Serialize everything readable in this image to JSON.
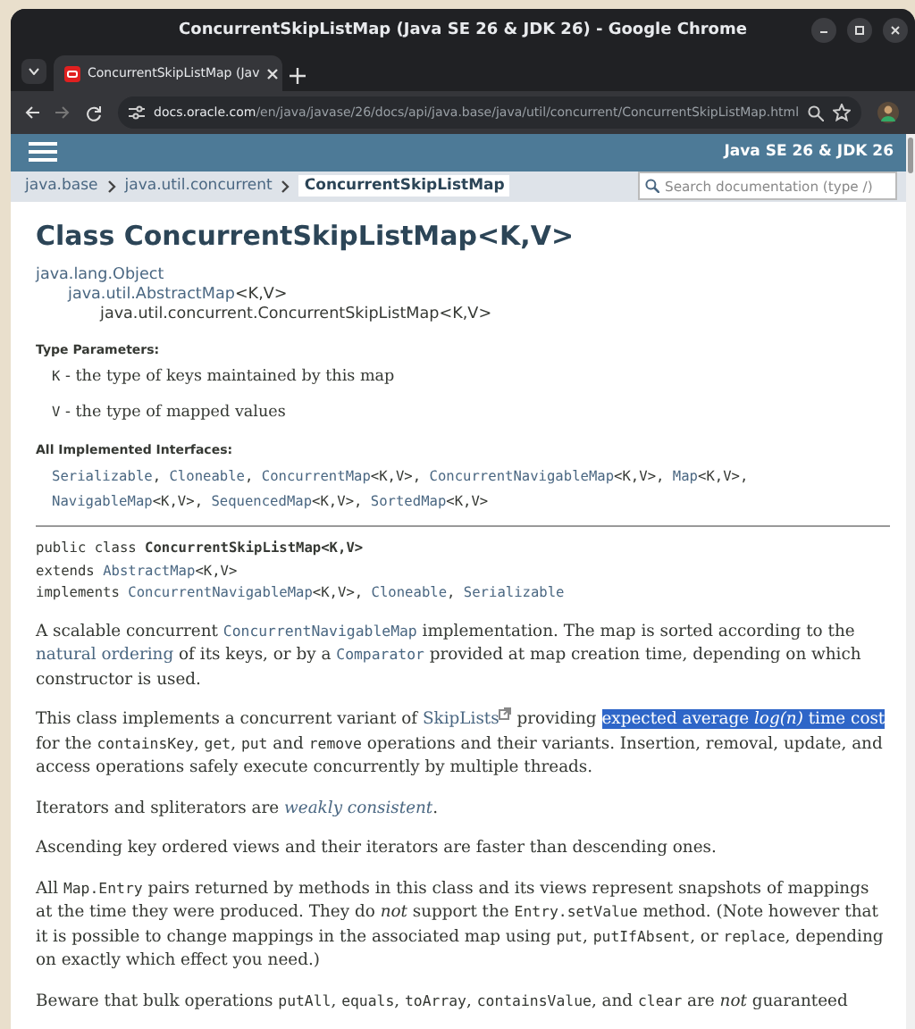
{
  "window": {
    "title": "ConcurrentSkipListMap (Java SE 26 & JDK 26) - Google Chrome"
  },
  "browser": {
    "tab_title": "ConcurrentSkipListMap (Jav",
    "url_host": "docs.oracle.com",
    "url_path": "/en/java/javase/26/docs/api/java.base/java/util/concurrent/ConcurrentSkipListMap.html"
  },
  "header": {
    "version": "Java SE 26 & JDK 26"
  },
  "breadcrumbs": [
    {
      "label": "java.base",
      "selected": false
    },
    {
      "label": "java.util.concurrent",
      "selected": false
    },
    {
      "label": "ConcurrentSkipListMap",
      "selected": true
    }
  ],
  "search": {
    "placeholder": "Search documentation (type /)"
  },
  "title": "Class ConcurrentSkipListMap<K,V>",
  "inheritance": [
    {
      "parts": [
        {
          "kind": "link",
          "text": "java.lang.Object"
        }
      ],
      "children": [
        {
          "parts": [
            {
              "kind": "link",
              "text": "java.util.AbstractMap"
            },
            {
              "kind": "text",
              "text": "<K,V>"
            }
          ],
          "children": [
            {
              "parts": [
                {
                  "kind": "text",
                  "text": "java.util.concurrent.ConcurrentSkipListMap<K,V>"
                }
              ]
            }
          ]
        }
      ]
    }
  ],
  "sections": [
    {
      "heading": "Type Parameters:",
      "items": [
        [
          {
            "kind": "code",
            "text": "K"
          },
          {
            "kind": "text",
            "text": " - the type of keys maintained by this map"
          }
        ],
        [
          {
            "kind": "code",
            "text": "V"
          },
          {
            "kind": "text",
            "text": " - the type of mapped values"
          }
        ]
      ]
    },
    {
      "heading": "All Implemented Interfaces:",
      "items": [
        [
          {
            "kind": "code-link",
            "text": "Serializable"
          },
          {
            "kind": "code",
            "text": ", "
          },
          {
            "kind": "code-link",
            "text": "Cloneable"
          },
          {
            "kind": "code",
            "text": ", "
          },
          {
            "kind": "code-link",
            "text": "ConcurrentMap"
          },
          {
            "kind": "code",
            "text": "<K,V>, "
          },
          {
            "kind": "code-link",
            "text": "ConcurrentNavigableMap"
          },
          {
            "kind": "code",
            "text": "<K,V>, "
          },
          {
            "kind": "code-link",
            "text": "Map"
          },
          {
            "kind": "code",
            "text": "<K,V>, "
          },
          {
            "kind": "code-link",
            "text": "NavigableMap"
          },
          {
            "kind": "code",
            "text": "<K,V>, "
          },
          {
            "kind": "code-link",
            "text": "SequencedMap"
          },
          {
            "kind": "code",
            "text": "<K,V>, "
          },
          {
            "kind": "code-link",
            "text": "SortedMap"
          },
          {
            "kind": "code",
            "text": "<K,V>"
          }
        ]
      ]
    }
  ],
  "signature": [
    [
      {
        "kind": "code",
        "text": "public class "
      },
      {
        "kind": "code-bold",
        "text": "ConcurrentSkipListMap<K,V>"
      }
    ],
    [
      {
        "kind": "code",
        "text": "extends "
      },
      {
        "kind": "code-link",
        "text": "AbstractMap"
      },
      {
        "kind": "code",
        "text": "<K,V>"
      }
    ],
    [
      {
        "kind": "code",
        "text": "implements "
      },
      {
        "kind": "code-link",
        "text": "ConcurrentNavigableMap"
      },
      {
        "kind": "code",
        "text": "<K,V>, "
      },
      {
        "kind": "code-link",
        "text": "Cloneable"
      },
      {
        "kind": "code",
        "text": ", "
      },
      {
        "kind": "code-link",
        "text": "Serializable"
      }
    ]
  ],
  "paragraphs": [
    [
      {
        "kind": "text",
        "text": "A scalable concurrent "
      },
      {
        "kind": "code-link",
        "text": "ConcurrentNavigableMap"
      },
      {
        "kind": "text",
        "text": " implementation. The map is sorted according to the "
      },
      {
        "kind": "link",
        "text": "natural ordering"
      },
      {
        "kind": "text",
        "text": " of its keys, or by a "
      },
      {
        "kind": "code-link",
        "text": "Comparator"
      },
      {
        "kind": "text",
        "text": " provided at map creation time, depending on which constructor is used."
      }
    ],
    [
      {
        "kind": "text",
        "text": "This class implements a concurrent variant of "
      },
      {
        "kind": "external-link",
        "text": "SkipLists"
      },
      {
        "kind": "text",
        "text": " providing "
      },
      {
        "kind": "highlight",
        "text": "expected average "
      },
      {
        "kind": "highlight-em",
        "text": "log(n)"
      },
      {
        "kind": "highlight",
        "text": " time cost"
      },
      {
        "kind": "text",
        "text": " for the "
      },
      {
        "kind": "code",
        "text": "containsKey"
      },
      {
        "kind": "text",
        "text": ", "
      },
      {
        "kind": "code",
        "text": "get"
      },
      {
        "kind": "text",
        "text": ", "
      },
      {
        "kind": "code",
        "text": "put"
      },
      {
        "kind": "text",
        "text": " and "
      },
      {
        "kind": "code",
        "text": "remove"
      },
      {
        "kind": "text",
        "text": " operations and their variants. Insertion, removal, update, and access operations safely execute concurrently by multiple threads."
      }
    ],
    [
      {
        "kind": "text",
        "text": "Iterators and spliterators are "
      },
      {
        "kind": "em-link",
        "text": "weakly consistent"
      },
      {
        "kind": "text",
        "text": "."
      }
    ],
    [
      {
        "kind": "text",
        "text": "Ascending key ordered views and their iterators are faster than descending ones."
      }
    ],
    [
      {
        "kind": "text",
        "text": "All "
      },
      {
        "kind": "code",
        "text": "Map.Entry"
      },
      {
        "kind": "text",
        "text": " pairs returned by methods in this class and its views represent snapshots of mappings at the time they were produced. They do "
      },
      {
        "kind": "em",
        "text": "not"
      },
      {
        "kind": "text",
        "text": " support the "
      },
      {
        "kind": "code",
        "text": "Entry.setValue"
      },
      {
        "kind": "text",
        "text": " method. (Note however that it is possible to change mappings in the associated map using "
      },
      {
        "kind": "code",
        "text": "put"
      },
      {
        "kind": "text",
        "text": ", "
      },
      {
        "kind": "code",
        "text": "putIfAbsent"
      },
      {
        "kind": "text",
        "text": ", or "
      },
      {
        "kind": "code",
        "text": "replace"
      },
      {
        "kind": "text",
        "text": ", depending on exactly which effect you need.)"
      }
    ],
    [
      {
        "kind": "text",
        "text": "Beware that bulk operations "
      },
      {
        "kind": "code",
        "text": "putAll"
      },
      {
        "kind": "text",
        "text": ", "
      },
      {
        "kind": "code",
        "text": "equals"
      },
      {
        "kind": "text",
        "text": ", "
      },
      {
        "kind": "code",
        "text": "toArray"
      },
      {
        "kind": "text",
        "text": ", "
      },
      {
        "kind": "code",
        "text": "containsValue"
      },
      {
        "kind": "text",
        "text": ", and "
      },
      {
        "kind": "code",
        "text": "clear"
      },
      {
        "kind": "text",
        "text": " are "
      },
      {
        "kind": "em",
        "text": "not"
      },
      {
        "kind": "text",
        "text": " guaranteed"
      }
    ]
  ]
}
